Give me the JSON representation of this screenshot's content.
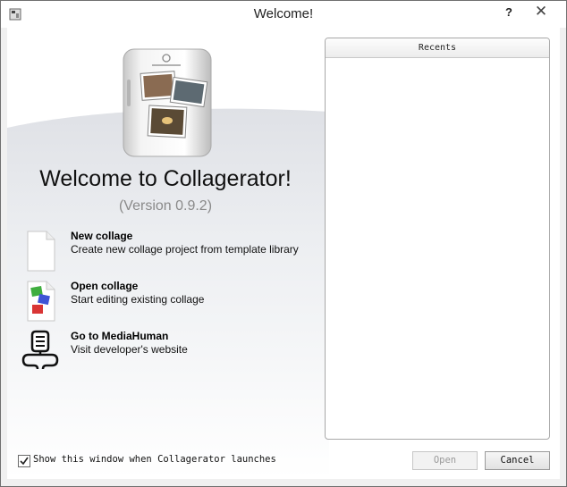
{
  "window": {
    "title": "Welcome!",
    "help_label": "?",
    "close_label": "✕"
  },
  "welcome": {
    "heading": "Welcome to Collagerator!",
    "version": "(Version 0.9.2)"
  },
  "actions": [
    {
      "label": "New collage",
      "description": "Create new collage project from template library",
      "icon": "blank-document-icon"
    },
    {
      "label": "Open collage",
      "description": "Start editing existing collage",
      "icon": "collage-document-icon"
    },
    {
      "label": "Go to MediaHuman",
      "description": "Visit developer's website",
      "icon": "mediahuman-logo-icon"
    }
  ],
  "recents": {
    "header": "Recents",
    "items": []
  },
  "footer": {
    "show_on_launch_label": "Show this window when Collagerator launches",
    "show_on_launch_checked": true,
    "open_label": "Open",
    "open_enabled": false,
    "cancel_label": "Cancel"
  },
  "colors": {
    "swoosh": "#e6e8ec",
    "window_bg": "#f0f0f0"
  }
}
